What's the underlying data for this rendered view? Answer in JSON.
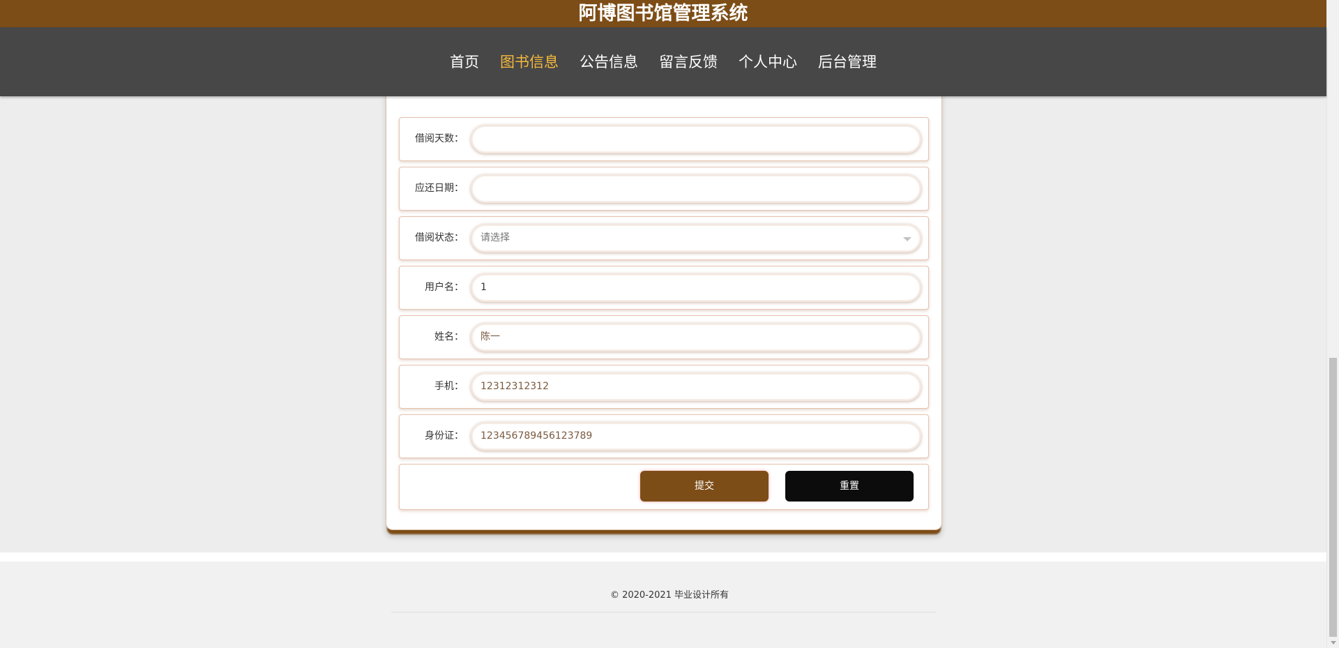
{
  "header": {
    "title": "阿博图书馆管理系统"
  },
  "nav": {
    "items": [
      {
        "label": "首页"
      },
      {
        "label": "图书信息"
      },
      {
        "label": "公告信息"
      },
      {
        "label": "留言反馈"
      },
      {
        "label": "个人中心"
      },
      {
        "label": "后台管理"
      }
    ],
    "active_index": 1
  },
  "form": {
    "fields": [
      {
        "label": "借阅天数：",
        "value": "",
        "placeholder": ""
      },
      {
        "label": "应还日期：",
        "value": "",
        "placeholder": ""
      },
      {
        "label": "借阅状态：",
        "value": "请选择",
        "type": "select"
      },
      {
        "label": "用户名：",
        "value": "1"
      },
      {
        "label": "姓名：",
        "value": "陈一"
      },
      {
        "label": "手机：",
        "value": "12312312312"
      },
      {
        "label": "身份证：",
        "value": "123456789456123789"
      }
    ],
    "submit_label": "提交",
    "reset_label": "重置"
  },
  "footer": {
    "copyright": "© 2020-2021 毕业设计所有"
  },
  "colors": {
    "brand": "#7d4d17",
    "nav_bg": "#474747",
    "nav_active": "#f5b83c",
    "reset_button": "#0c0c0c"
  }
}
